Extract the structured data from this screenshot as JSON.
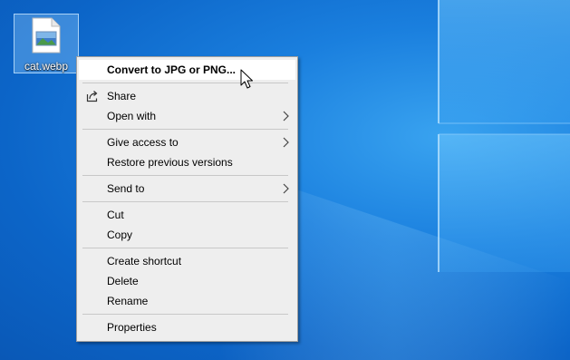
{
  "desktop": {
    "icon": {
      "label": "cat.webp",
      "icon_name": "image-file-icon"
    }
  },
  "context_menu": {
    "items": [
      {
        "id": "convert",
        "label": "Convert to JPG or PNG...",
        "bold": true,
        "highlighted": true
      },
      {
        "id": "share",
        "label": "Share",
        "icon": "share-icon"
      },
      {
        "id": "open-with",
        "label": "Open with",
        "submenu": true
      },
      {
        "id": "give-access",
        "label": "Give access to",
        "submenu": true
      },
      {
        "id": "restore",
        "label": "Restore previous versions"
      },
      {
        "id": "send-to",
        "label": "Send to",
        "submenu": true
      },
      {
        "id": "cut",
        "label": "Cut"
      },
      {
        "id": "copy",
        "label": "Copy"
      },
      {
        "id": "create-shortcut",
        "label": "Create shortcut"
      },
      {
        "id": "delete",
        "label": "Delete"
      },
      {
        "id": "rename",
        "label": "Rename"
      },
      {
        "id": "properties",
        "label": "Properties"
      }
    ]
  },
  "colors": {
    "desktop_bg": "#1a7fde",
    "menu_bg": "#eeeeee",
    "menu_highlight": "#ffffff",
    "separator": "#c8c8c8"
  }
}
